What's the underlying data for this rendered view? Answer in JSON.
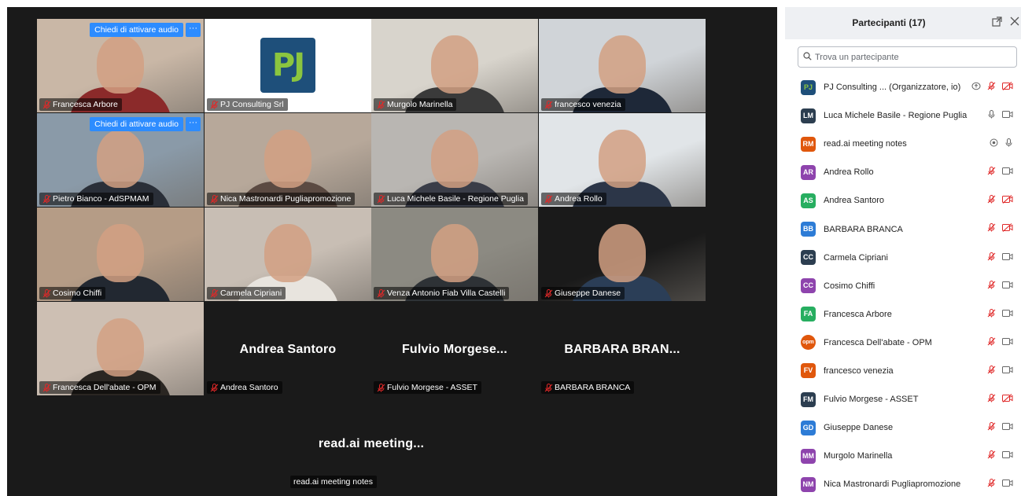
{
  "stage": {
    "audio_request_label": "Chiedi di attivare audio",
    "more_label": "···",
    "tiles": [
      {
        "name": "Francesca Arbore",
        "bg": "#c9b7a6",
        "body": "#8b2a2a",
        "audio_request": true
      },
      {
        "name": "PJ Consulting Srl",
        "bg": "#ffffff",
        "logo": "PJ"
      },
      {
        "name": "Murgolo Marinella",
        "bg": "#d8d4cc",
        "body": "#3a3a3a"
      },
      {
        "name": "francesco venezia",
        "bg": "#d0d4d8",
        "body": "#1e2838"
      },
      {
        "name": "Pietro Bianco - AdSPMAM",
        "bg": "#8a9aa8",
        "body": "#2a2f38",
        "audio_request": true
      },
      {
        "name": "Nica Mastronardi Pugliapromozione",
        "bg": "#b7a89a",
        "body": "#5b4a42"
      },
      {
        "name": "Luca Michele Basile - Regione Puglia",
        "bg": "#b9b6b2",
        "body": "#3a3d48",
        "active": true
      },
      {
        "name": "Andrea Rollo",
        "bg": "#e1e5e8",
        "body": "#2c3648"
      },
      {
        "name": "Cosimo Chiffi",
        "bg": "#b59c86",
        "body": "#222831"
      },
      {
        "name": "Carmela Cipriani",
        "bg": "#c8beb4",
        "body": "#e8e4de"
      },
      {
        "name": "Venza Antonio Fiab Villa Castelli",
        "bg": "#8c8a82",
        "body": "#2e3236"
      },
      {
        "name": "Giuseppe Danese",
        "bg": "#1a1a1a",
        "body": "#2b3e57"
      },
      {
        "name": "Francesca Dell'abate - OPM",
        "bg": "#cdbfb3",
        "body": "#2a2622"
      },
      {
        "name": "Andrea Santoro",
        "big": "Andrea Santoro"
      },
      {
        "name": "Fulvio Morgese - ASSET",
        "big": "Fulvio  Morgese..."
      },
      {
        "name": "BARBARA BRANCA",
        "big": "BARBARA  BRAN..."
      }
    ],
    "bottom": {
      "big": "read.ai  meeting...",
      "name": "read.ai meeting notes"
    }
  },
  "panel": {
    "title": "Partecipanti (17)",
    "search_placeholder": "Trova un partecipante",
    "participants": [
      {
        "initials": "PJ",
        "name": "PJ Consulting ...  (Organizzatore, io)",
        "color": "#2f6e34",
        "icons": [
          "share-screen",
          "mic-off",
          "video-off"
        ]
      },
      {
        "initials": "LM",
        "name": "Luca Michele Basile - Regione Puglia",
        "color": "#2c3e50",
        "icons": [
          "mic-on",
          "video-on"
        ]
      },
      {
        "initials": "RM",
        "name": "read.ai meeting notes",
        "color": "#e0570c",
        "icons": [
          "record",
          "mic-on"
        ]
      },
      {
        "initials": "AR",
        "name": "Andrea Rollo",
        "color": "#8e44ad",
        "icons": [
          "mic-off",
          "video-on"
        ]
      },
      {
        "initials": "AS",
        "name": "Andrea Santoro",
        "color": "#27ae60",
        "icons": [
          "mic-off",
          "video-off"
        ]
      },
      {
        "initials": "BB",
        "name": "BARBARA BRANCA",
        "color": "#2d7cd6",
        "icons": [
          "mic-off",
          "video-off"
        ]
      },
      {
        "initials": "CC",
        "name": "Carmela Cipriani",
        "color": "#2c3e50",
        "icons": [
          "mic-off",
          "video-on"
        ]
      },
      {
        "initials": "CC",
        "name": "Cosimo Chiffi",
        "color": "#8e44ad",
        "icons": [
          "mic-off",
          "video-on"
        ]
      },
      {
        "initials": "FA",
        "name": "Francesca Arbore",
        "color": "#27ae60",
        "icons": [
          "mic-off",
          "video-on"
        ]
      },
      {
        "initials": "opm",
        "name": "Francesca Dell'abate - OPM",
        "color": "#e0570c",
        "round": true,
        "icons": [
          "mic-off",
          "video-on"
        ]
      },
      {
        "initials": "FV",
        "name": "francesco venezia",
        "color": "#e0570c",
        "icons": [
          "mic-off",
          "video-on"
        ]
      },
      {
        "initials": "FM",
        "name": "Fulvio Morgese - ASSET",
        "color": "#2c3e50",
        "icons": [
          "mic-off",
          "video-off"
        ]
      },
      {
        "initials": "GD",
        "name": "Giuseppe Danese",
        "color": "#2d7cd6",
        "icons": [
          "mic-off",
          "video-on"
        ]
      },
      {
        "initials": "MM",
        "name": "Murgolo Marinella",
        "color": "#8e44ad",
        "icons": [
          "mic-off",
          "video-on"
        ]
      },
      {
        "initials": "NM",
        "name": "Nica Mastronardi Pugliapromozione",
        "color": "#8e44ad",
        "icons": [
          "mic-off",
          "video-on"
        ]
      }
    ]
  },
  "colors": {
    "accent": "#2d8cff",
    "muted_red": "#e02828",
    "active_border": "#3ecf8e"
  }
}
